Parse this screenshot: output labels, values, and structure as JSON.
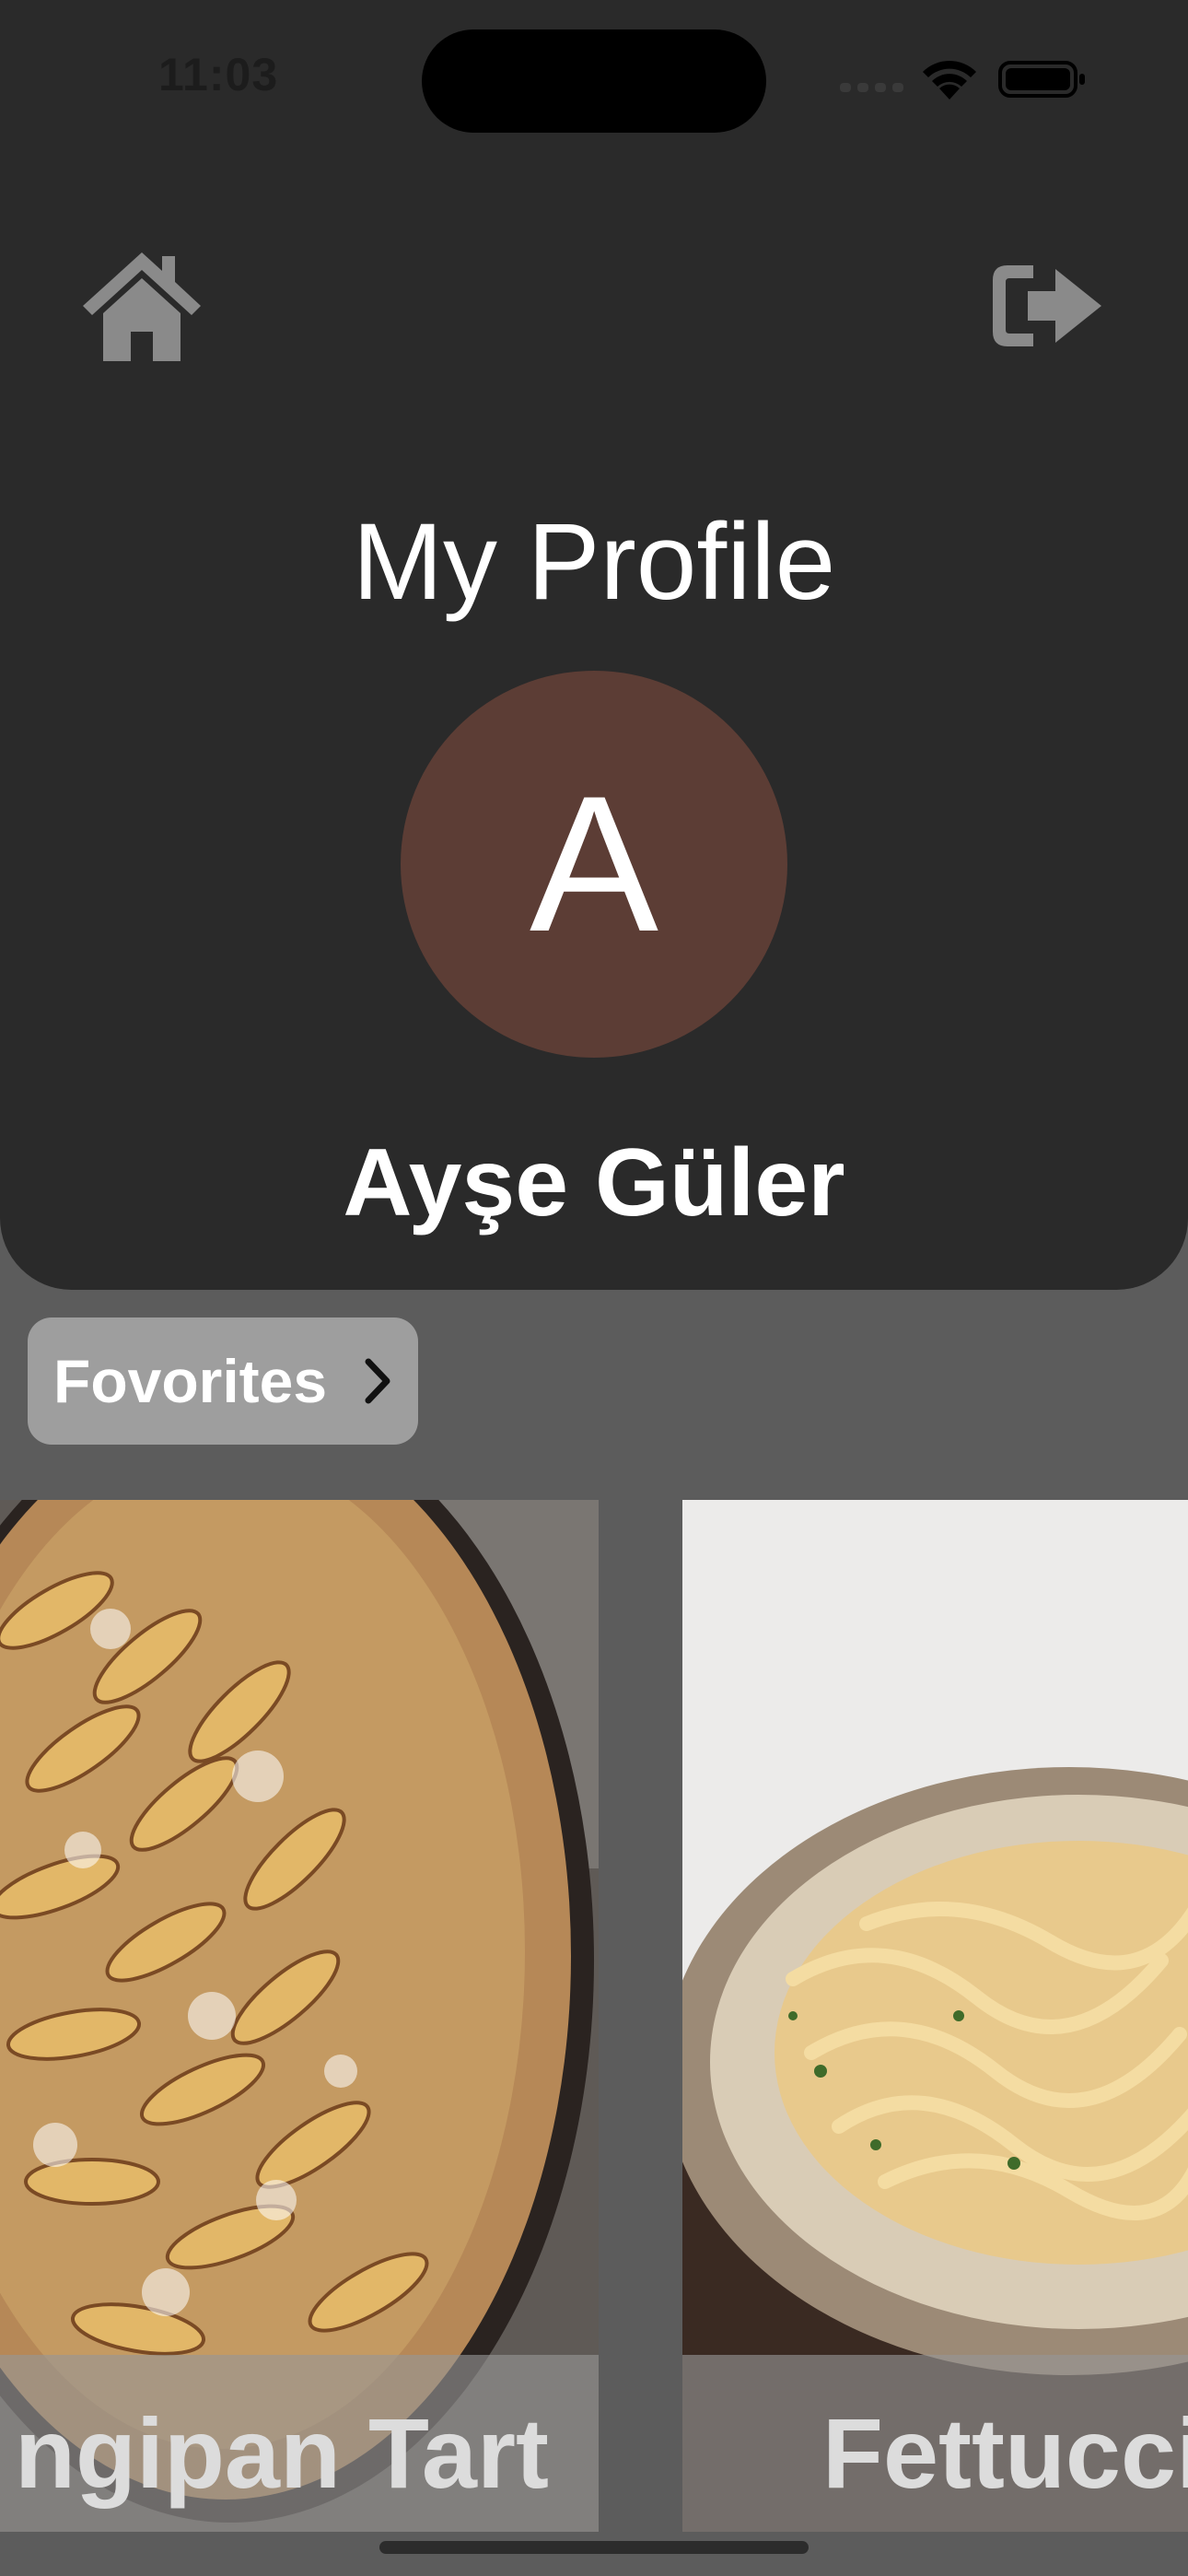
{
  "status_bar": {
    "time": "11:03"
  },
  "nav": {
    "home_icon": "home-icon",
    "logout_icon": "logout-icon"
  },
  "profile": {
    "title": "My Profile",
    "avatar_initial": "A",
    "avatar_color": "#5c3d35",
    "name": "Ayşe Güler"
  },
  "favorites": {
    "label": "Fovorites",
    "chevron_icon": "chevron-right-icon",
    "items": [
      {
        "name": "Frangipan Tart",
        "visible_caption": "ngipan Tart"
      },
      {
        "name": "Fettuccine",
        "visible_caption": "Fettucci"
      }
    ]
  },
  "colors": {
    "header_bg": "#2a2a2a",
    "page_bg": "#5c5c5c",
    "button_bg": "#9e9e9e",
    "icon_gray": "#8a8a8a"
  }
}
